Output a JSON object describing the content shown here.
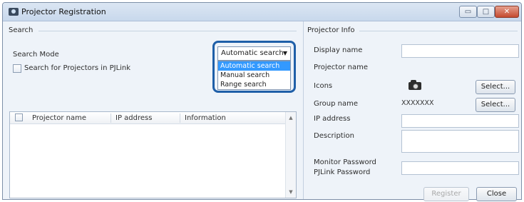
{
  "window": {
    "title": "Projector Registration",
    "minimize_glyph": "▭",
    "maximize_glyph": "□",
    "close_glyph": "✕"
  },
  "search": {
    "group_title": "Search",
    "mode_label": "Search Mode",
    "pjlink_checkbox_label": "Search for Projectors in PJLink",
    "pjlink_checked": false,
    "mode_selected": "Automatic search",
    "mode_options": [
      "Automatic search",
      "Manual search",
      "Range search"
    ],
    "dropdown_arrow": "▼"
  },
  "table": {
    "columns": [
      "Projector name",
      "IP address",
      "Information"
    ],
    "rows": [],
    "scroll_up": "▲",
    "scroll_down": "▼"
  },
  "projector_info": {
    "group_title": "Projector Info",
    "display_name_label": "Display name",
    "display_name_value": "",
    "projector_name_label": "Projector name",
    "icons_label": "Icons",
    "icons_select_button": "Select...",
    "group_name_label": "Group name",
    "group_name_value": "XXXXXXX",
    "group_select_button": "Select...",
    "ip_address_label": "IP address",
    "ip_address_value": "",
    "description_label": "Description",
    "description_value": "",
    "monitor_password_label": "Monitor Password",
    "pjlink_password_label": "PJLink Password",
    "register_button": "Register",
    "close_button": "Close"
  },
  "colors": {
    "highlight_border": "#1f5fa8",
    "selected_option_bg": "#3399ff",
    "window_bg": "#eef3f9"
  },
  "icons": [
    "projector-icon",
    "camera-icon",
    "minimize-icon",
    "maximize-icon",
    "close-icon",
    "chevron-down-icon"
  ]
}
